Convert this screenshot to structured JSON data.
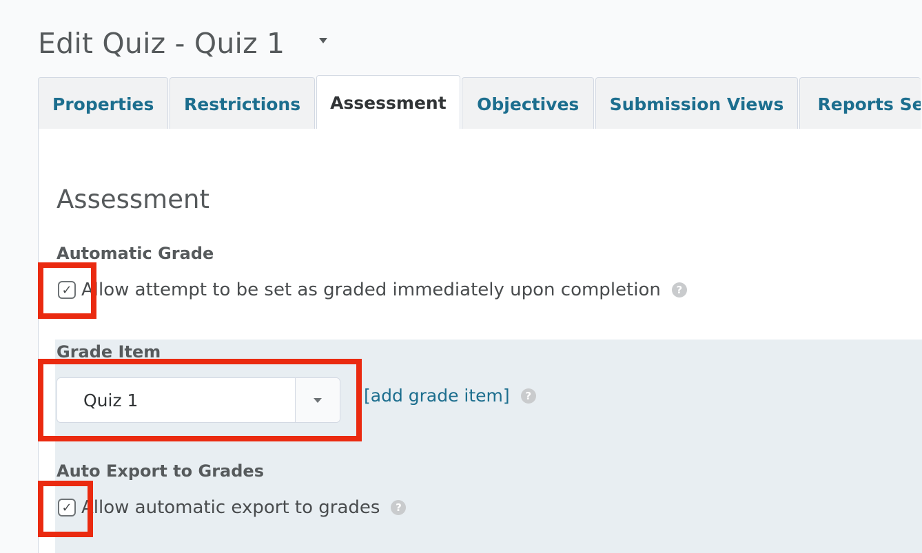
{
  "header": {
    "title": "Edit Quiz - Quiz 1"
  },
  "tabs": [
    {
      "label": "Properties",
      "active": false
    },
    {
      "label": "Restrictions",
      "active": false
    },
    {
      "label": "Assessment",
      "active": true
    },
    {
      "label": "Objectives",
      "active": false
    },
    {
      "label": "Submission Views",
      "active": false
    },
    {
      "label": "Reports Se",
      "active": false
    }
  ],
  "assessment": {
    "heading": "Assessment",
    "automatic_grade": {
      "label": "Automatic Grade",
      "checkbox_text": "Allow attempt to be set as graded immediately upon completion",
      "checked": true
    },
    "grade_item": {
      "label": "Grade Item",
      "selected_value": "Quiz 1",
      "add_link": "[add grade item]"
    },
    "auto_export": {
      "label": "Auto Export to Grades",
      "checkbox_text": "Allow automatic export to grades",
      "checked": true
    }
  },
  "glyphs": {
    "check": "✓",
    "help": "?"
  },
  "colors": {
    "link": "#1c6e8e",
    "highlight": "#ea2a10",
    "band": "#e8eef2"
  }
}
